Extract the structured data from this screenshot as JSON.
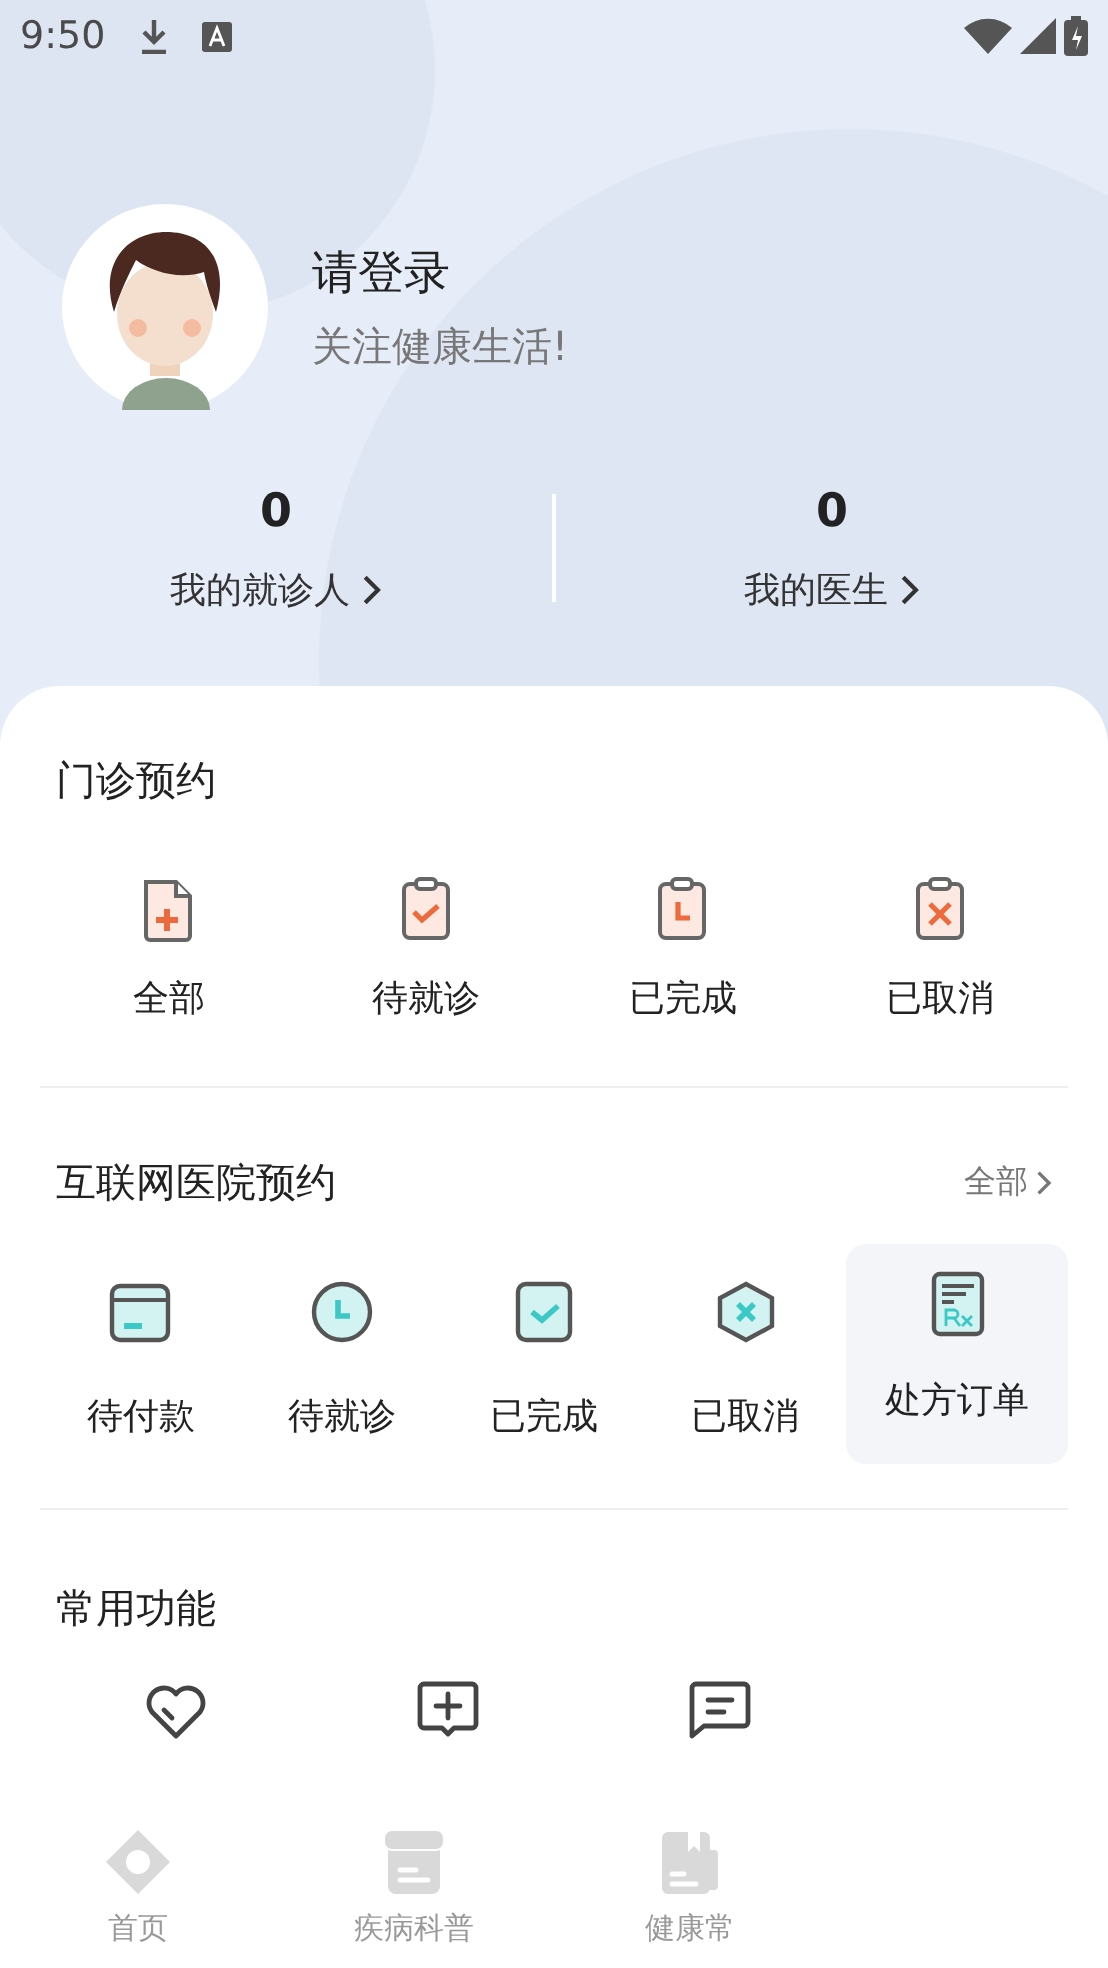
{
  "status_bar": {
    "time": "9:50"
  },
  "profile": {
    "name": "请登录",
    "tagline": "关注健康生活!"
  },
  "stats": [
    {
      "value": "0",
      "label": "我的就诊人"
    },
    {
      "value": "0",
      "label": "我的医生"
    }
  ],
  "outpatient": {
    "title": "门诊预约",
    "items": [
      {
        "kind": "all",
        "label": "全部"
      },
      {
        "kind": "pending",
        "label": "待就诊"
      },
      {
        "kind": "done",
        "label": "已完成"
      },
      {
        "kind": "cancelled",
        "label": "已取消"
      }
    ]
  },
  "online": {
    "title": "互联网医院预约",
    "more": "全部",
    "items": [
      {
        "kind": "unpaid",
        "label": "待付款",
        "selected": false
      },
      {
        "kind": "pending",
        "label": "待就诊",
        "selected": false
      },
      {
        "kind": "done",
        "label": "已完成",
        "selected": false
      },
      {
        "kind": "cancelled",
        "label": "已取消",
        "selected": false
      },
      {
        "kind": "prescription",
        "label": "处方订单",
        "selected": true
      }
    ]
  },
  "common": {
    "title": "常用功能",
    "items": [
      {
        "kind": "heart"
      },
      {
        "kind": "add-message"
      },
      {
        "kind": "message"
      }
    ]
  },
  "tab_bar": [
    {
      "kind": "home",
      "label": "首页",
      "selected": false
    },
    {
      "kind": "science",
      "label": "疾病科普",
      "selected": false
    },
    {
      "kind": "knowledge",
      "label": "健康常",
      "selected": false
    }
  ]
}
